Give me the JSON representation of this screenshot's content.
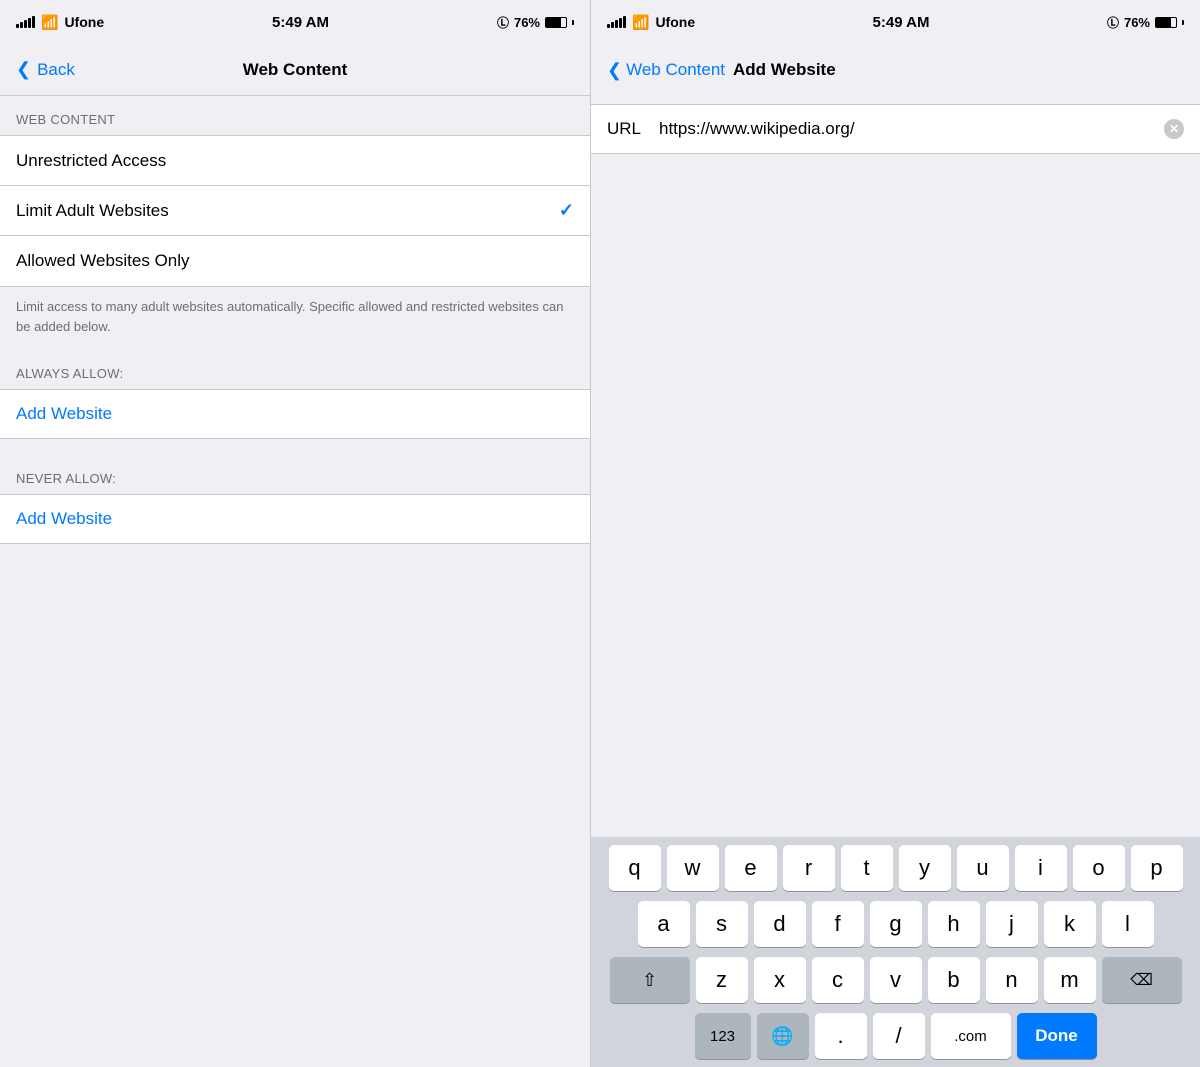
{
  "left": {
    "status": {
      "carrier": "Ufone",
      "time": "5:49 AM",
      "battery": "76%"
    },
    "nav": {
      "back_label": "Back",
      "title": "Web Content"
    },
    "section_header": "WEB CONTENT",
    "options": [
      {
        "label": "Unrestricted Access",
        "checked": false
      },
      {
        "label": "Limit Adult Websites",
        "checked": true
      },
      {
        "label": "Allowed Websites Only",
        "checked": false
      }
    ],
    "description": "Limit access to many adult websites automatically. Specific allowed and restricted websites can be added below.",
    "always_allow_header": "ALWAYS ALLOW:",
    "never_allow_header": "NEVER ALLOW:",
    "add_website_label": "Add Website"
  },
  "right": {
    "status": {
      "carrier": "Ufone",
      "time": "5:49 AM",
      "battery": "76%"
    },
    "nav": {
      "back_label": "Web Content",
      "title": "Add Website"
    },
    "url_label": "URL",
    "url_value": "https://www.wikipedia.org/",
    "keyboard": {
      "row1": [
        "q",
        "w",
        "e",
        "r",
        "t",
        "y",
        "u",
        "i",
        "o",
        "p"
      ],
      "row2": [
        "a",
        "s",
        "d",
        "f",
        "g",
        "h",
        "j",
        "k",
        "l"
      ],
      "row3": [
        "z",
        "x",
        "c",
        "v",
        "b",
        "n",
        "m"
      ],
      "bottom": {
        "nums": "123",
        "globe": "🌐",
        "dot": ".",
        "slash": "/",
        "dotcom": ".com",
        "done": "Done"
      }
    }
  }
}
